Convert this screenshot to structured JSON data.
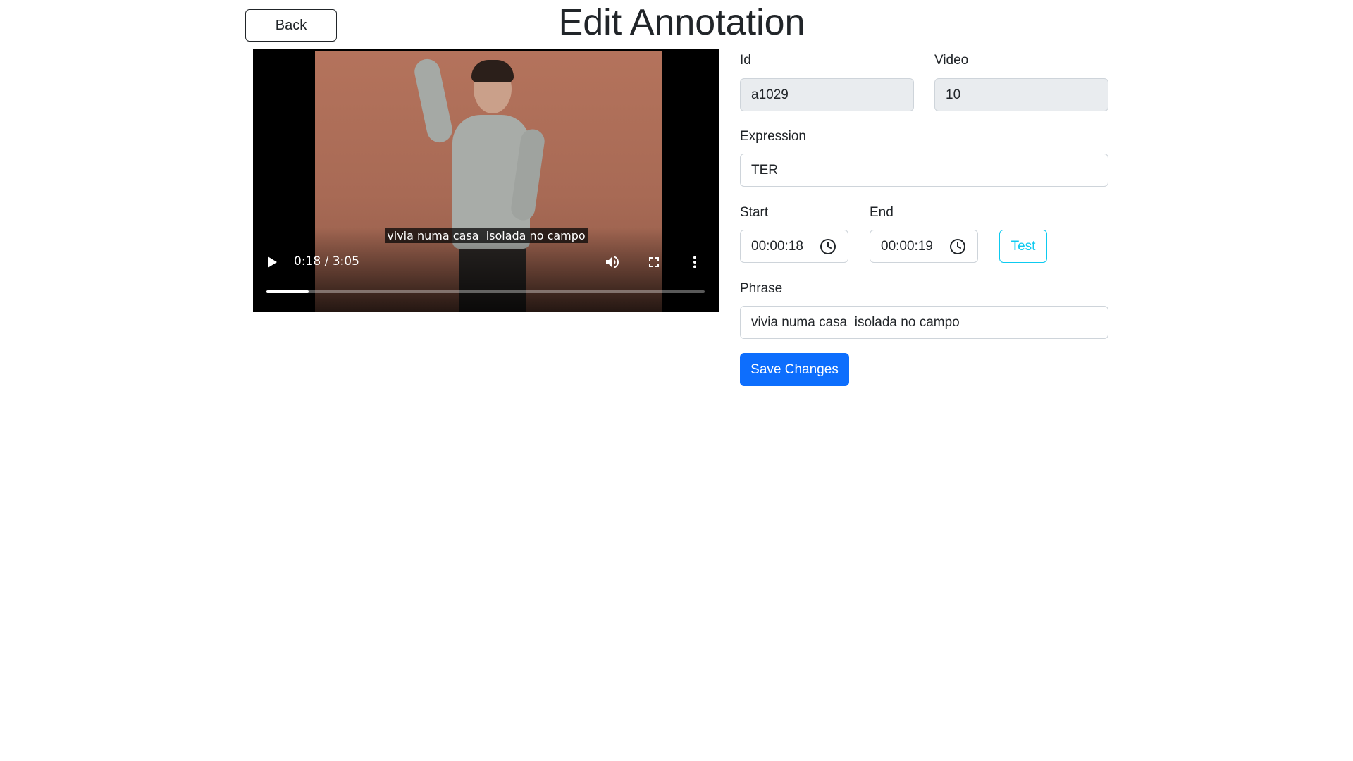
{
  "header": {
    "back_label": "Back",
    "title": "Edit Annotation"
  },
  "video": {
    "caption": "vivia numa casa  isolada no campo",
    "time": "0:18 / 3:05",
    "progress": 0.097,
    "icons": {
      "play": "play-icon",
      "volume": "volume-icon",
      "fullscreen": "fullscreen-icon",
      "more": "more-options-icon"
    }
  },
  "form": {
    "id": {
      "label": "Id",
      "value": "a1029"
    },
    "video": {
      "label": "Video",
      "value": "10"
    },
    "expression": {
      "label": "Expression",
      "value": "TER"
    },
    "start": {
      "label": "Start",
      "value": "00:00:18"
    },
    "end": {
      "label": "End",
      "value": "00:00:19"
    },
    "test_label": "Test",
    "phrase": {
      "label": "Phrase",
      "value": "vivia numa casa  isolada no campo"
    },
    "save_label": "Save Changes"
  },
  "colors": {
    "primary": "#0d6efd",
    "info": "#0dcaf0",
    "readonly_bg": "#e9ecef",
    "border": "#ced4da"
  }
}
